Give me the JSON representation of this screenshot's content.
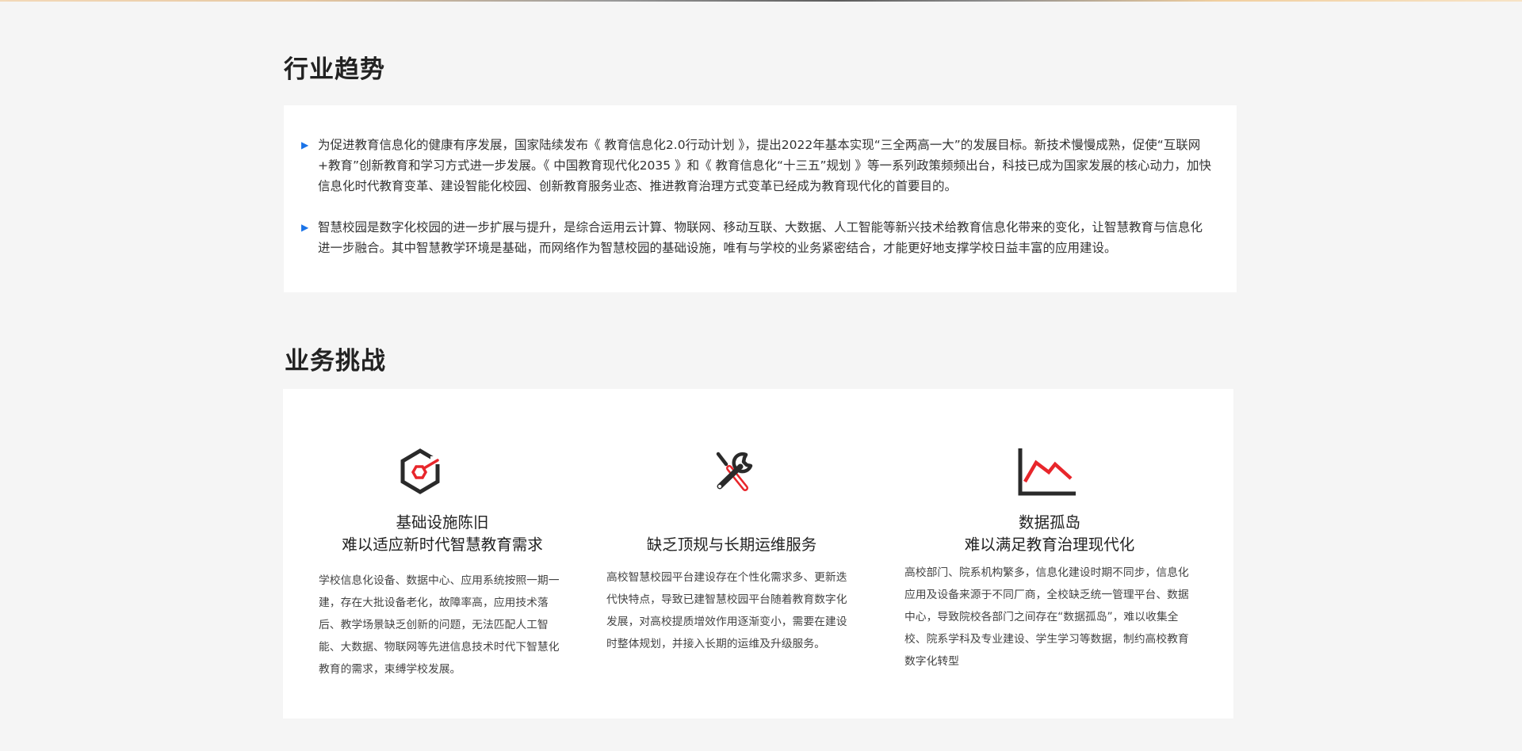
{
  "trend": {
    "title": "行业趋势",
    "items": [
      {
        "text": "为促进教育信息化的健康有序发展，国家陆续发布《 教育信息化2.0行动计划 》，提出2022年基本实现“三全两高一大”的发展目标。新技术慢慢成熟，促使“互联网+教育”创新教育和学习方式进一步发展。《 中国教育现代化2035 》和《 教育信息化“十三五”规划 》等一系列政策频频出台，科技已成为国家发展的核心动力，加快信息化时代教育变革、建设智能化校园、创新教育服务业态、推进教育治理方式变革已经成为教育现代化的首要目的。"
      },
      {
        "text": "智慧校园是数字化校园的进一步扩展与提升，是综合运用云计算、物联网、移动互联、大数据、人工智能等新兴技术给教育信息化带来的变化，让智慧教育与信息化进一步融合。其中智慧教学环境是基础，而网络作为智慧校园的基础设施，唯有与学校的业务紧密结合，才能更好地支撑学校日益丰富的应用建设。"
      }
    ]
  },
  "challenge": {
    "title": "业务挑战",
    "columns": [
      {
        "icon": "hexagon-cube-icon",
        "title_line1": "基础设施陈旧",
        "title_line2": "难以适应新时代智慧教育需求",
        "desc": "学校信息化设备、数据中心、应用系统按照一期一建，存在大批设备老化，故障率高，应用技术落后、教学场景缺乏创新的问题，无法匹配人工智能、大数据、物联网等先进信息技术时代下智慧化教育的需求，束缚学校发展。"
      },
      {
        "icon": "tools-icon",
        "title_line1": "缺乏顶规与长期运维服务",
        "desc": "高校智慧校园平台建设存在个性化需求多、更新迭代快特点，导致已建智慧校园平台随着教育数字化发展，对高校提质增效作用逐渐变小，需要在建设时整体规划，并接入长期的运维及升级服务。"
      },
      {
        "icon": "declining-chart-icon",
        "title_line1": "数据孤岛",
        "title_line2": "难以满足教育治理现代化",
        "desc": "高校部门、院系机构繁多，信息化建设时期不同步，信息化应用及设备来源于不同厂商，全校缺乏统一管理平台、数据中心，导致院校各部门之间存在“数据孤岛”，难以收集全校、院系学科及专业建设、学生学习等数据，制约高校教育数字化转型"
      }
    ]
  },
  "colors": {
    "accent_blue": "#1a73e8",
    "accent_red": "#e8262b",
    "icon_dark": "#2a2a2a",
    "background": "#f5f5f5"
  }
}
